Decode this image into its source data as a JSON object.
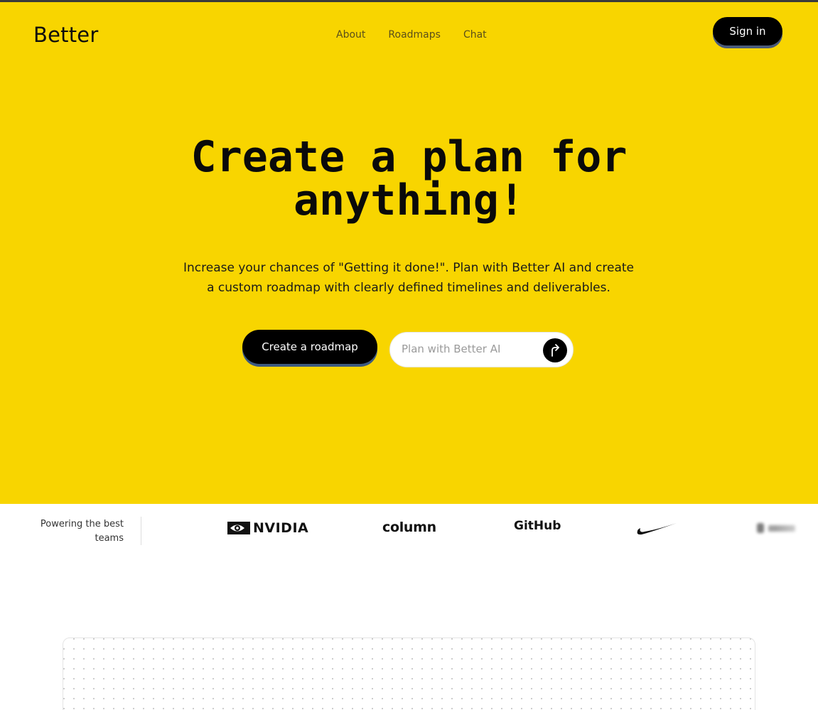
{
  "brand": "Better",
  "nav": {
    "items": [
      "About",
      "Roadmaps",
      "Chat"
    ]
  },
  "header": {
    "signin_label": "Sign in"
  },
  "hero": {
    "title_line1": "Create a plan for",
    "title_line2": "anything!",
    "subtitle": "Increase your chances of \"Getting it done!\". Plan with Better AI and create a custom roadmap with clearly defined timelines and deliverables.",
    "cta_label": "Create a roadmap",
    "plan_placeholder": "Plan with Better AI"
  },
  "logos": {
    "caption": "Powering the best teams",
    "items": [
      "NVIDIA",
      "column",
      "GitHub",
      "Nike"
    ]
  },
  "colors": {
    "hero_bg": "#f8d500",
    "button_bg": "#000000",
    "button_shadow": "#3d5a80"
  }
}
